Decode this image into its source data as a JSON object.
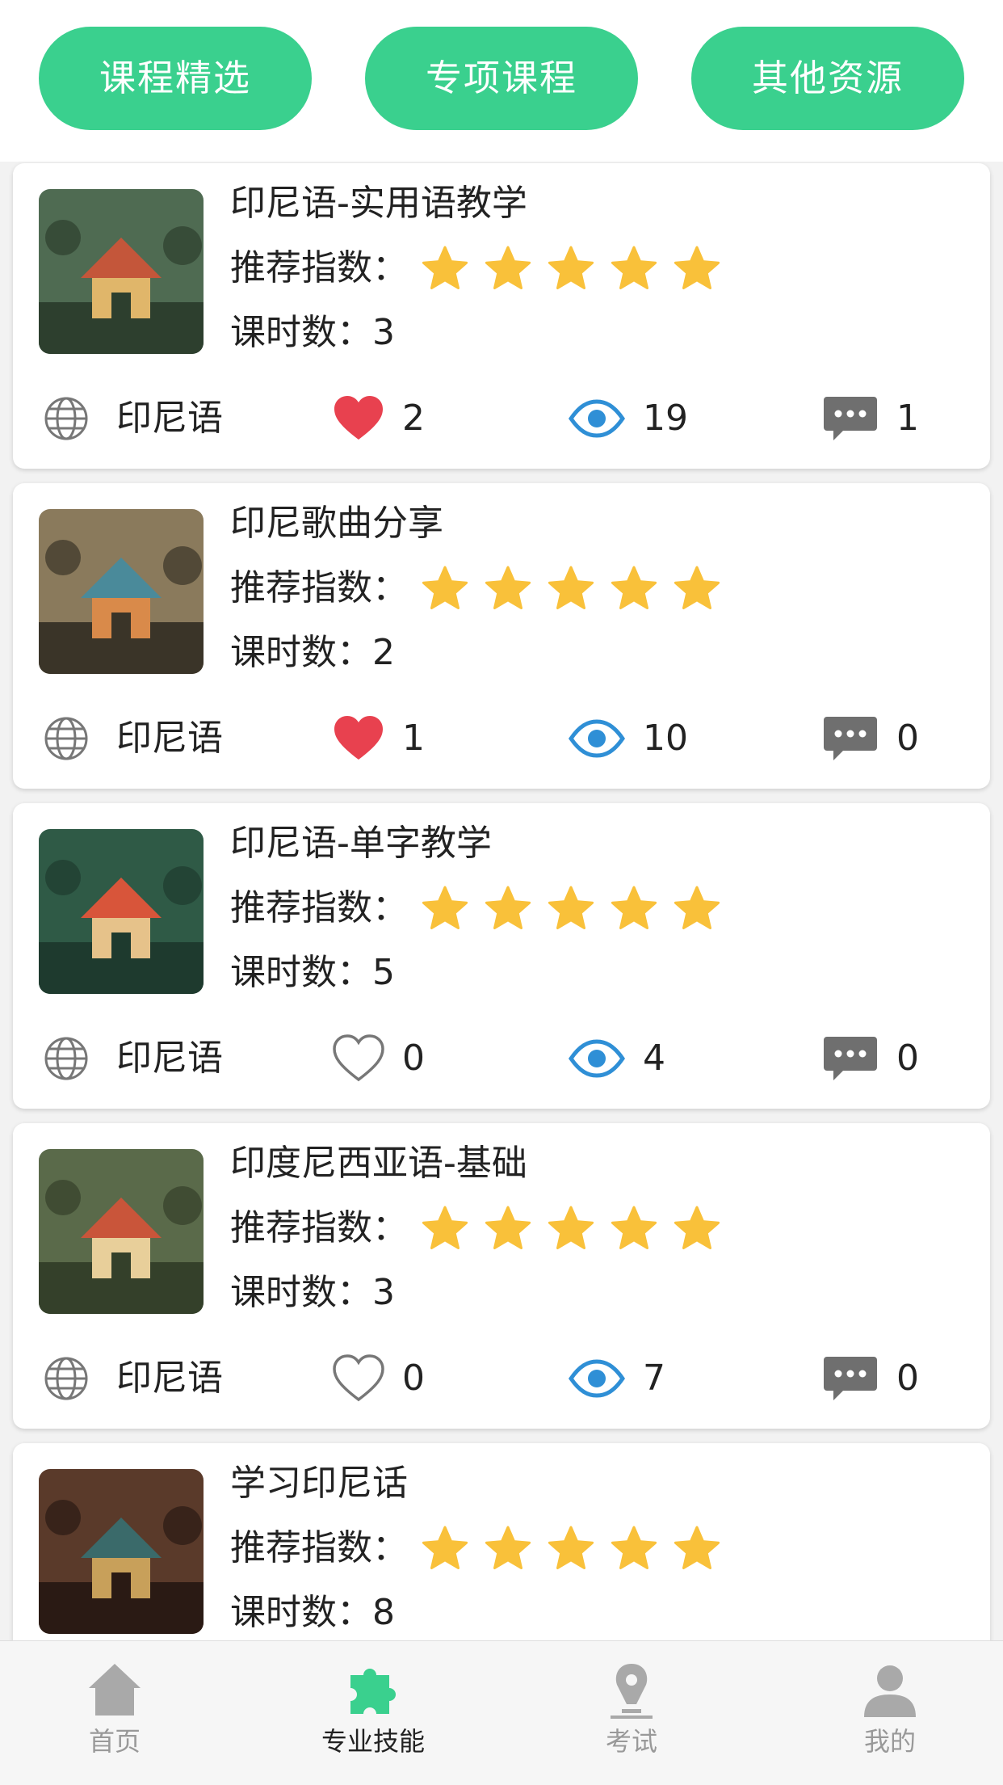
{
  "tabs": [
    {
      "label": "课程精选"
    },
    {
      "label": "专项课程"
    },
    {
      "label": "其他资源"
    }
  ],
  "rating_label": "推荐指数：",
  "courses": [
    {
      "title": "印尼语-实用语教学",
      "rating": 5,
      "hours_text": "课时数：3",
      "language": "印尼语",
      "likes": "2",
      "liked": true,
      "views": "19",
      "comments": "1"
    },
    {
      "title": "印尼歌曲分享",
      "rating": 5,
      "hours_text": "课时数：2",
      "language": "印尼语",
      "likes": "1",
      "liked": true,
      "views": "10",
      "comments": "0"
    },
    {
      "title": "印尼语-单字教学",
      "rating": 5,
      "hours_text": "课时数：5",
      "language": "印尼语",
      "likes": "0",
      "liked": false,
      "views": "4",
      "comments": "0"
    },
    {
      "title": "印度尼西亚语-基础",
      "rating": 5,
      "hours_text": "课时数：3",
      "language": "印尼语",
      "likes": "0",
      "liked": false,
      "views": "7",
      "comments": "0"
    },
    {
      "title": "学习印尼话",
      "rating": 5,
      "hours_text": "课时数：8"
    }
  ],
  "nav": [
    {
      "label": "首页",
      "icon": "home-icon"
    },
    {
      "label": "专业技能",
      "icon": "puzzle-icon"
    },
    {
      "label": "考试",
      "icon": "pen-nib-icon"
    },
    {
      "label": "我的",
      "icon": "user-icon"
    }
  ],
  "colors": {
    "accent": "#3ad08e",
    "star": "#f9c13a",
    "heart": "#e8414f",
    "eye": "#2f8fd6",
    "icon_gray": "#666666"
  }
}
